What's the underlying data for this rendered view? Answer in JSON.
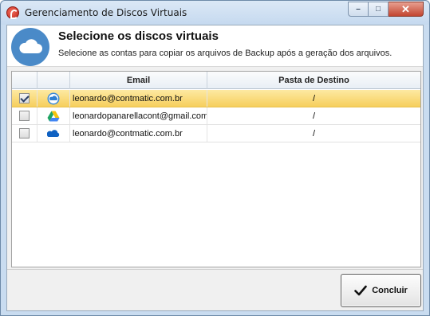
{
  "window": {
    "title": "Gerenciamento de Discos Virtuais",
    "controls": {
      "minimize": "–",
      "maximize": "□",
      "close": "✕"
    }
  },
  "header": {
    "title": "Selecione os discos virtuais",
    "subtitle": "Selecione as contas para copiar os arquivos de Backup após a geração dos arquivos.",
    "icon": "cloud-icon"
  },
  "grid": {
    "columns": {
      "check": "",
      "icon": "",
      "email": "Email",
      "destination": "Pasta de Destino"
    },
    "rows": [
      {
        "checked": true,
        "service_icon": "onedrive-icon",
        "email": "leonardo@contmatic.com.br",
        "destination": "/",
        "selected": true
      },
      {
        "checked": false,
        "service_icon": "google-drive-icon",
        "email": "leonardopanarellacont@gmail.com",
        "destination": "/",
        "selected": false
      },
      {
        "checked": false,
        "service_icon": "onedrive-icon",
        "email": "leonardo@contmatic.com.br",
        "destination": "/",
        "selected": false
      }
    ]
  },
  "footer": {
    "done_label": "Concluir",
    "done_icon": "checkmark-icon"
  }
}
